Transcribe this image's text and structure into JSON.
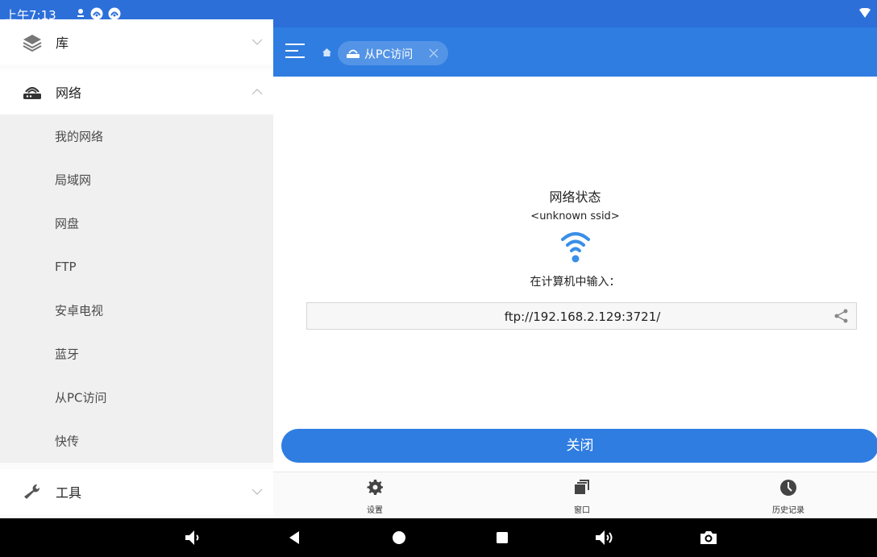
{
  "status_bar": {
    "time": "上午7:13"
  },
  "sidebar": {
    "sections": [
      {
        "label": "库",
        "icon": "layers-icon",
        "expanded": false
      },
      {
        "label": "网络",
        "icon": "router-icon",
        "expanded": true
      },
      {
        "label": "工具",
        "icon": "wrench-icon",
        "expanded": false
      }
    ],
    "network_items": [
      "我的网络",
      "局域网",
      "网盘",
      "FTP",
      "安卓电视",
      "蓝牙",
      "从PC访问",
      "快传"
    ]
  },
  "header": {
    "tab_label": "从PC访问",
    "color": "#2f7de1"
  },
  "main": {
    "status_title": "网络状态",
    "ssid": "<unknown ssid>",
    "instruction": "在计算机中输入：",
    "ftp_url": "ftp://192.168.2.129:3721/",
    "close_label": "关闭"
  },
  "toolbar": {
    "settings_label": "设置",
    "windows_label": "窗口",
    "history_label": "历史记录"
  },
  "colors": {
    "accent": "#2f7de1",
    "status_bar": "#2c6fd9",
    "wifi": "#3a8ee8"
  }
}
